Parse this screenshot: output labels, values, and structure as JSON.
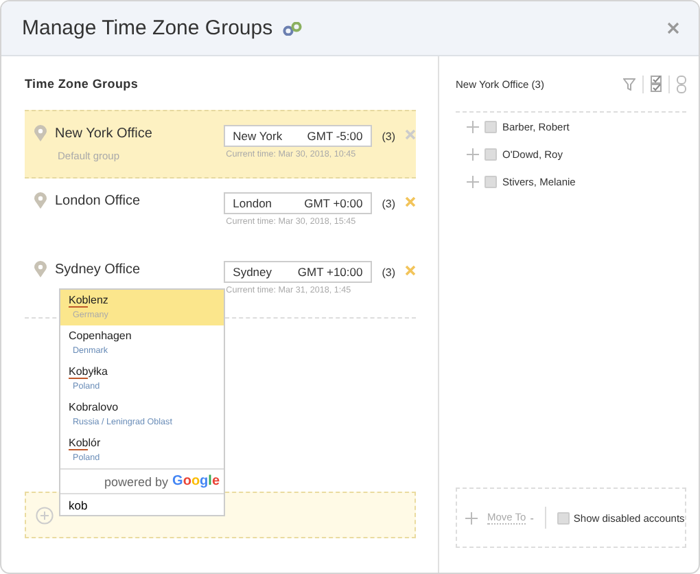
{
  "window": {
    "title": "Manage Time Zone Groups"
  },
  "groups_panel": {
    "title": "Time Zone Groups",
    "groups": [
      {
        "name": "New York Office",
        "subtitle": "Default group",
        "city": "New York",
        "offset": "GMT -5:00",
        "count": "(3)",
        "time": "Current time: Mar 30, 2018, 10:45",
        "selected": true,
        "deletable": false
      },
      {
        "name": "London Office",
        "city": "London",
        "offset": "GMT +0:00",
        "count": "(3)",
        "time": "Current time: Mar 30, 2018, 15:45",
        "selected": false,
        "deletable": true
      },
      {
        "name": "Sydney Office",
        "city": "Sydney",
        "offset": "GMT +10:00",
        "count": "(3)",
        "time": "Current time: Mar 31, 2018, 1:45",
        "selected": false,
        "deletable": true
      }
    ],
    "add_field": {
      "value": "kob"
    }
  },
  "autocomplete": {
    "suggestions": [
      {
        "match": "Kob",
        "rest": "lenz",
        "region": "Germany",
        "selected": true
      },
      {
        "rest": "Copenhagen",
        "region": "Denmark",
        "selected": false
      },
      {
        "match": "Kob",
        "rest": "yłka",
        "region": "Poland",
        "selected": false
      },
      {
        "rest": "Kobralovo",
        "region": "Russia / Leningrad Oblast",
        "selected": false
      },
      {
        "match": "Kob",
        "rest": "lór",
        "region": "Poland",
        "selected": false
      }
    ],
    "attribution": "powered by",
    "brand": "Google"
  },
  "members_panel": {
    "title": "New York Office (3)",
    "members": [
      {
        "name": "Barber, Robert",
        "checked": false
      },
      {
        "name": "O'Dowd, Roy",
        "checked": false
      },
      {
        "name": "Stivers, Melanie",
        "checked": false
      }
    ],
    "move_to": "Move To",
    "move_caret": "-",
    "show_disabled": {
      "label": "Show disabled accounts",
      "checked": false
    }
  }
}
